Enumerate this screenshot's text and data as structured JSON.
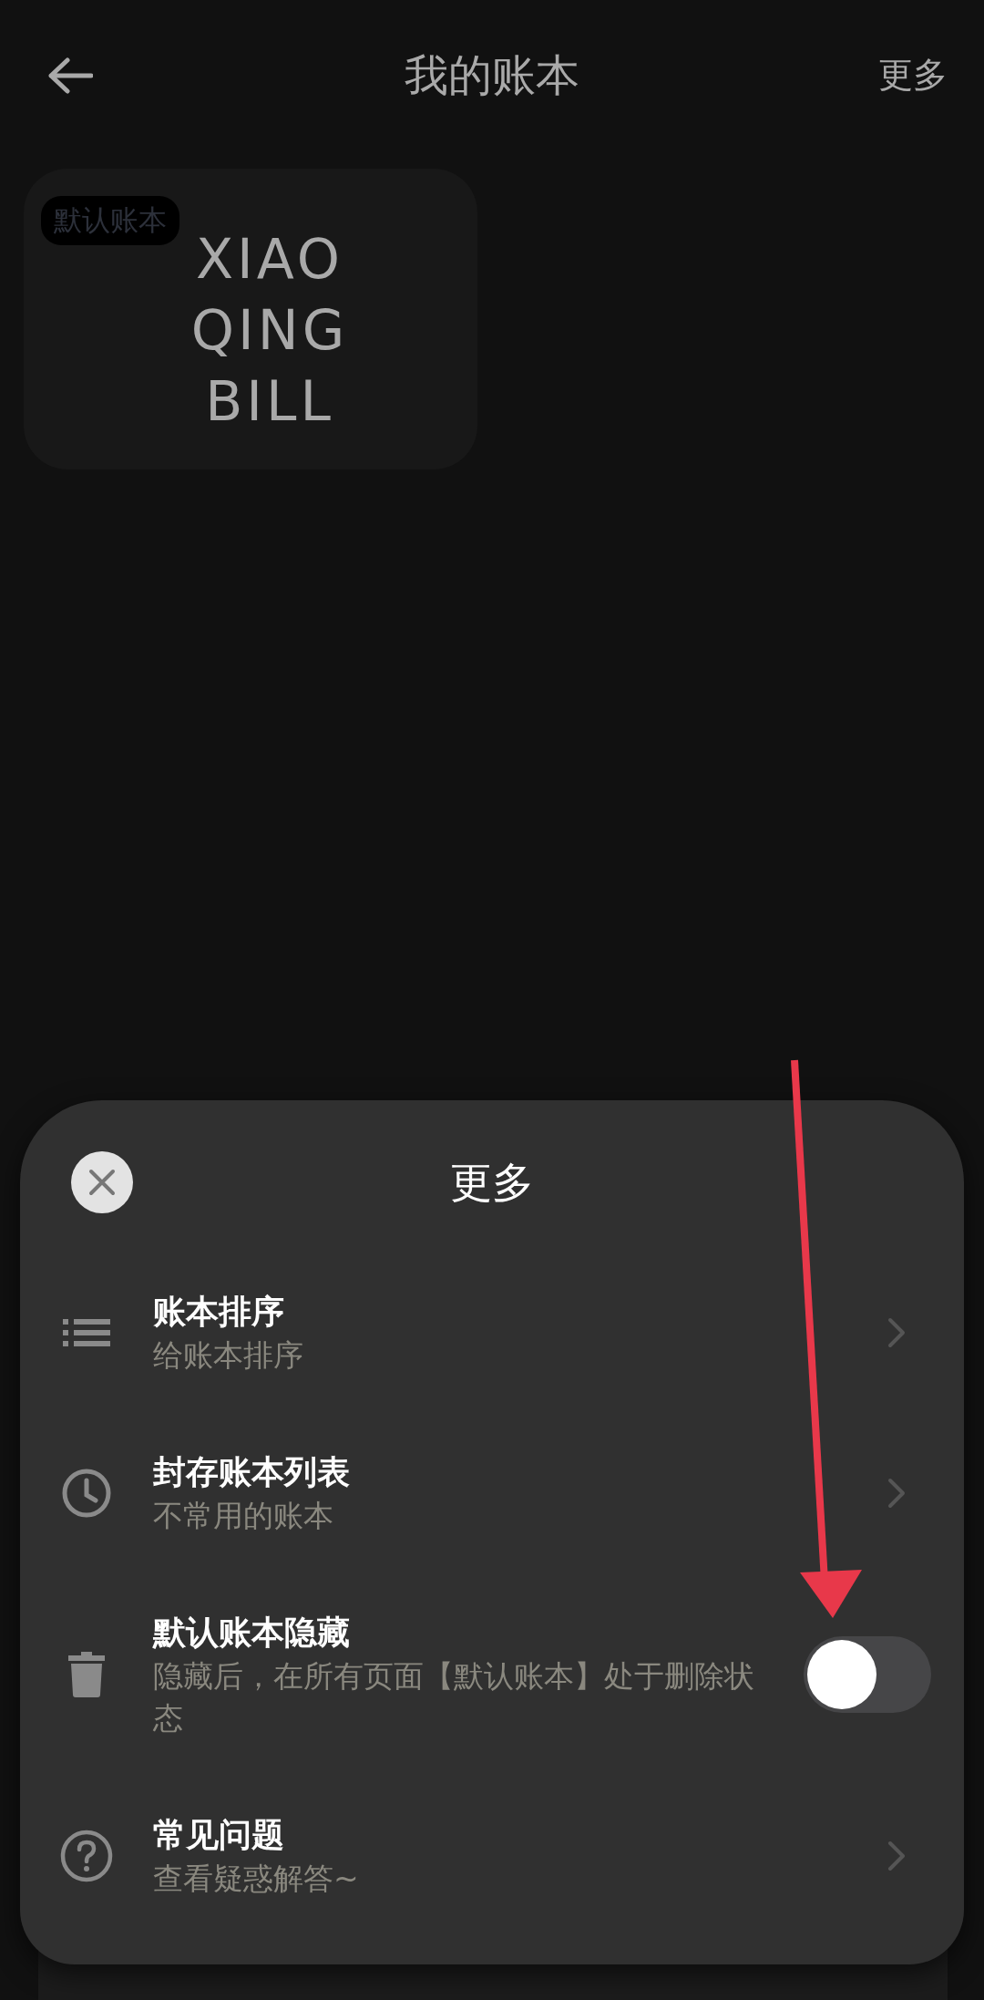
{
  "header": {
    "title": "我的账本",
    "action": "更多"
  },
  "books": [
    {
      "badge": "默认账本",
      "logo_lines": [
        "XIAO",
        "QING",
        "BILL"
      ]
    }
  ],
  "sheet": {
    "title": "更多",
    "items": [
      {
        "kind": "link",
        "title": "账本排序",
        "subtitle": "给账本排序"
      },
      {
        "kind": "link",
        "title": "封存账本列表",
        "subtitle": "不常用的账本"
      },
      {
        "kind": "toggle",
        "title": "默认账本隐藏",
        "subtitle": "隐藏后，在所有页面【默认账本】处于删除状态",
        "on": false
      },
      {
        "kind": "link",
        "title": "常见问题",
        "subtitle": "查看疑惑解答~"
      }
    ]
  }
}
